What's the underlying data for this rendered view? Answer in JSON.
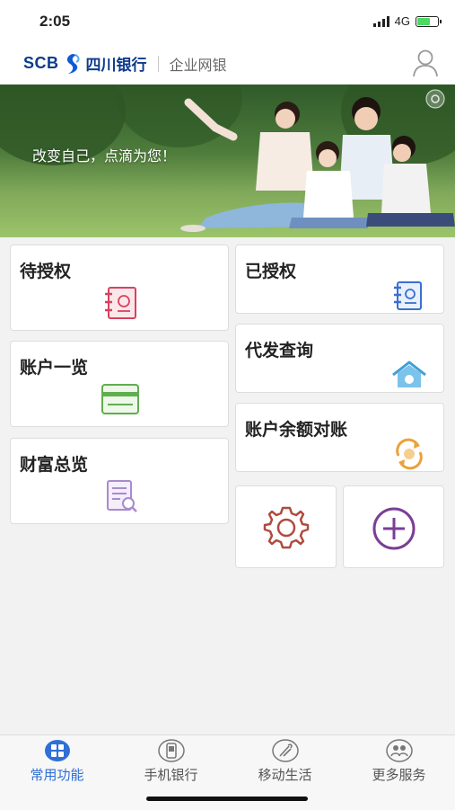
{
  "status_bar": {
    "time": "2:05",
    "network": "4G"
  },
  "header": {
    "logo_text": "SCB",
    "bank_name": "四川银行",
    "subtitle": "企业网银"
  },
  "banner": {
    "slogan": "改变自己，点滴为您！"
  },
  "cards": {
    "pending_auth": "待授权",
    "authorized": "已授权",
    "account_overview": "账户一览",
    "payroll_query": "代发查询",
    "balance_reconciliation": "账户余额对账",
    "wealth_overview": "财富总览"
  },
  "icons": {
    "pending_auth": "notebook-icon",
    "authorized": "notebook-icon",
    "account_overview": "card-icon",
    "payroll_query": "house-icon",
    "balance_reconciliation": "refresh-icon",
    "wealth_overview": "document-search-icon",
    "settings": "gear-icon",
    "add": "plus-circle-icon"
  },
  "colors": {
    "brand": "#0d3b8c",
    "active_tab": "#2f6fd6",
    "pending_icon": "#d6435e",
    "authorized_icon": "#3a6fd0",
    "account_icon": "#5fae4e",
    "payroll_icon": "#3f9fd8",
    "balance_icon": "#e9a33a",
    "wealth_icon": "#a98ad0",
    "settings_icon": "#b14a3e",
    "add_icon": "#7b3e96"
  },
  "tabs": [
    {
      "label": "常用功能",
      "active": true
    },
    {
      "label": "手机银行",
      "active": false
    },
    {
      "label": "移动生活",
      "active": false
    },
    {
      "label": "更多服务",
      "active": false
    }
  ]
}
